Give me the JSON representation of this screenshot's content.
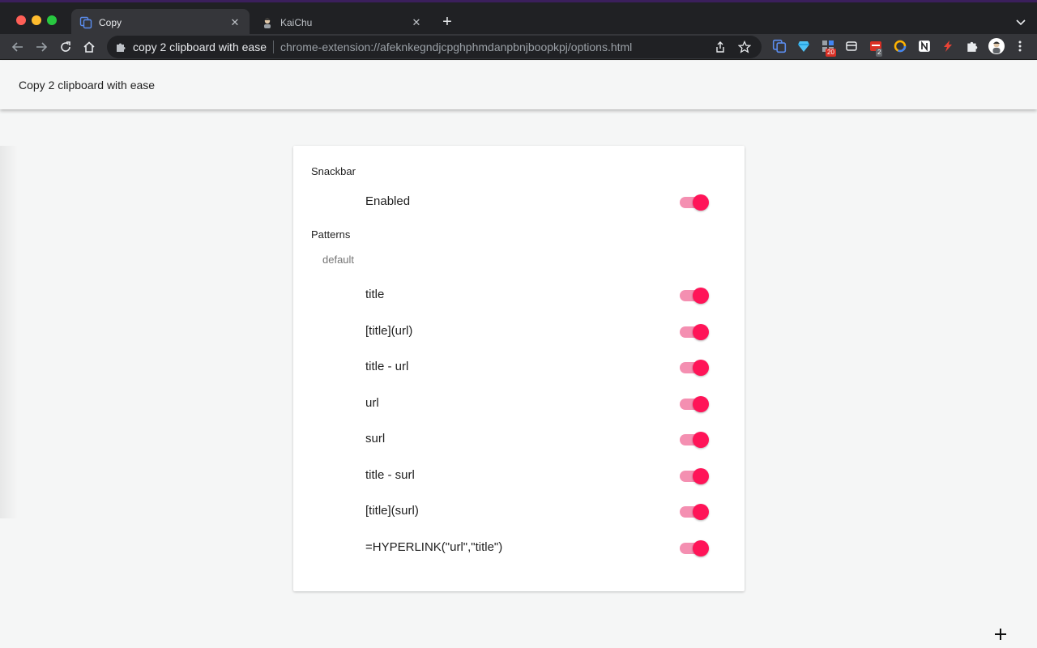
{
  "browser": {
    "tabs": [
      {
        "label": "Copy",
        "active": true,
        "icon": "copy-icon"
      },
      {
        "label": "KaiChu",
        "active": false,
        "icon": "avatar-icon"
      }
    ],
    "omnibox": {
      "extension_name": "copy 2 clipboard with ease",
      "url": "chrome-extension://afeknkegndjcpghphmdanpbnjboopkpj/options.html"
    },
    "extension_badges": {
      "first": "20",
      "second": "2"
    }
  },
  "page": {
    "app_title": "Copy 2 clipboard with ease",
    "snackbar": {
      "title": "Snackbar",
      "items": [
        {
          "label": "Enabled",
          "enabled": true
        }
      ]
    },
    "patterns": {
      "title": "Patterns",
      "subheader": "default",
      "items": [
        {
          "label": "title",
          "enabled": true
        },
        {
          "label": "[title](url)",
          "enabled": true
        },
        {
          "label": "title - url",
          "enabled": true
        },
        {
          "label": "url",
          "enabled": true
        },
        {
          "label": "surl",
          "enabled": true
        },
        {
          "label": "title - surl",
          "enabled": true
        },
        {
          "label": "[title](surl)",
          "enabled": true
        },
        {
          "label": "=HYPERLINK(\"url\",\"title\")",
          "enabled": true
        }
      ]
    }
  },
  "colors": {
    "accent": "#ff1458",
    "accent_track": "#f48fb1",
    "background": "#f5f6f6",
    "card": "#ffffff"
  }
}
